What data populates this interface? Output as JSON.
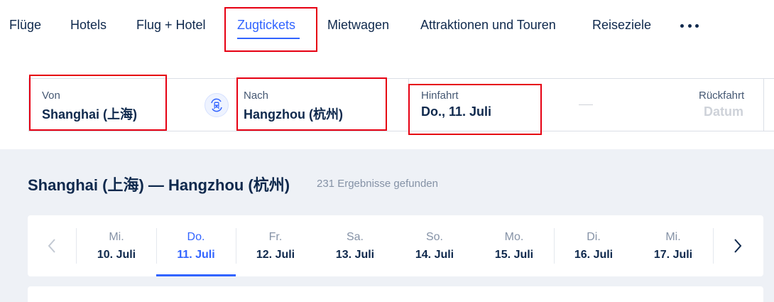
{
  "nav": {
    "items": [
      {
        "label": "Flüge"
      },
      {
        "label": "Hotels"
      },
      {
        "label": "Flug + Hotel"
      },
      {
        "label": "Zugtickets",
        "active": true
      },
      {
        "label": "Mietwagen"
      },
      {
        "label": "Attraktionen und Touren"
      },
      {
        "label": "Reiseziele"
      }
    ],
    "more_icon": "more-dots-icon",
    "accent_color": "#3264ff"
  },
  "search": {
    "from": {
      "label": "Von",
      "value": "Shanghai (上海)"
    },
    "swap_icon": "train-swap-icon",
    "to": {
      "label": "Nach",
      "value": "Hangzhou (杭州)"
    },
    "depart": {
      "label": "Hinfahrt",
      "value": "Do., 11. Juli"
    },
    "return": {
      "label": "Rückfahrt",
      "placeholder": "Datum"
    }
  },
  "results": {
    "route": "Shanghai (上海) — Hangzhou (杭州)",
    "count": "231 Ergebnisse gefunden"
  },
  "date_strip": {
    "prev_icon": "chevron-left-icon",
    "next_icon": "chevron-right-icon",
    "days": [
      {
        "dow": "Mi.",
        "date": "10. Juli"
      },
      {
        "dow": "Do.",
        "date": "11. Juli",
        "active": true
      },
      {
        "dow": "Fr.",
        "date": "12. Juli"
      },
      {
        "dow": "Sa.",
        "date": "13. Juli"
      },
      {
        "dow": "So.",
        "date": "14. Juli"
      },
      {
        "dow": "Mo.",
        "date": "15. Juli"
      },
      {
        "dow": "Di.",
        "date": "16. Juli"
      },
      {
        "dow": "Mi.",
        "date": "17. Juli"
      }
    ]
  },
  "highlight_color": "#e60012"
}
